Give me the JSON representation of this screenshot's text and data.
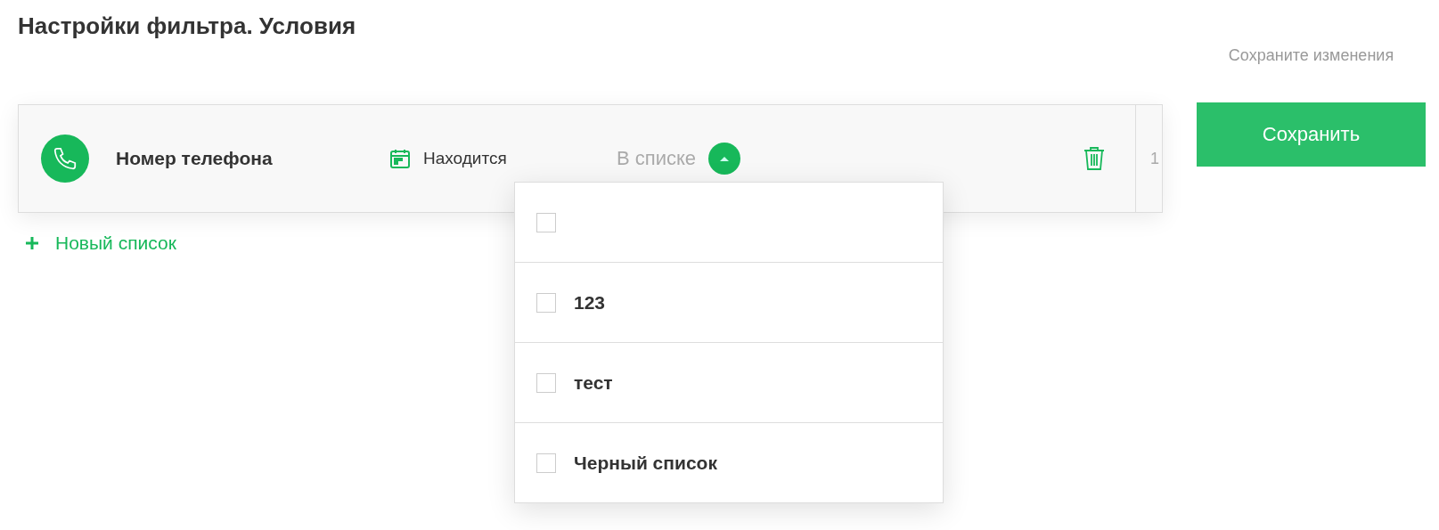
{
  "title": "Настройки фильтра. Условия",
  "condition": {
    "field": "Номер телефона",
    "operator": "Находится",
    "value": "В списке",
    "expanded": true,
    "index": "1",
    "options": [
      {
        "checked": false
      },
      {
        "label": "123",
        "checked": false
      },
      {
        "label": "тест",
        "checked": false
      },
      {
        "label": "Черный список",
        "checked": false
      }
    ]
  },
  "add_link": "Новый список",
  "save_hint": "Сохраните изменения",
  "save_button": "Сохранить"
}
